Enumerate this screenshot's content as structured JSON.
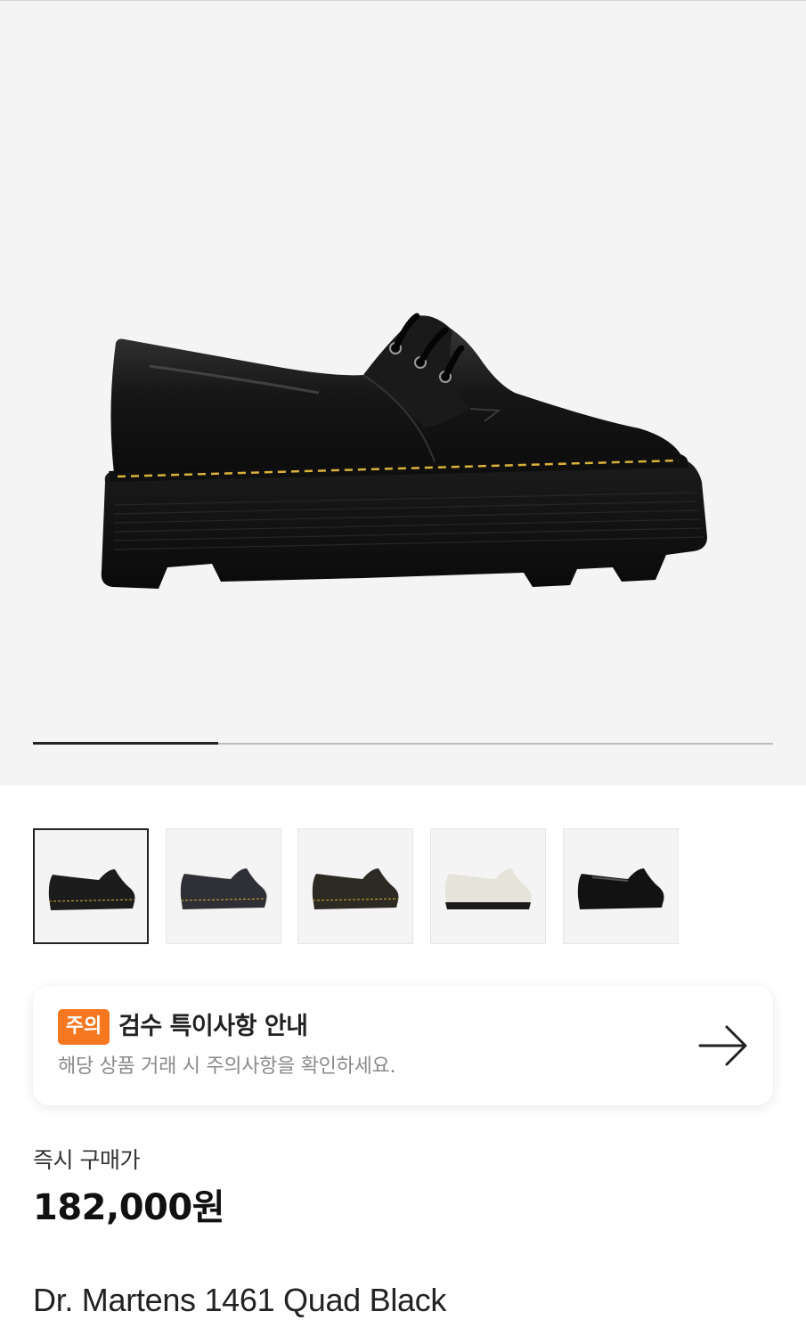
{
  "gallery": {
    "progress_fraction": 0.25,
    "image_count": 5,
    "thumbnail_colors": [
      "#1c1c1c",
      "#2f2f36",
      "#2c2a22",
      "#e6e3da",
      "#121212"
    ]
  },
  "notice": {
    "badge": "주의",
    "title": "검수 특이사항 안내",
    "subtitle": "해당 상품 거래 시 주의사항을 확인하세요.",
    "arrow_icon": "arrow-right-icon"
  },
  "price": {
    "label": "즉시 구매가",
    "value": "182,000원"
  },
  "product": {
    "name": "Dr. Martens 1461 Quad Black"
  },
  "colors": {
    "accent": "#f5771f",
    "stitch": "#d9b23a"
  }
}
